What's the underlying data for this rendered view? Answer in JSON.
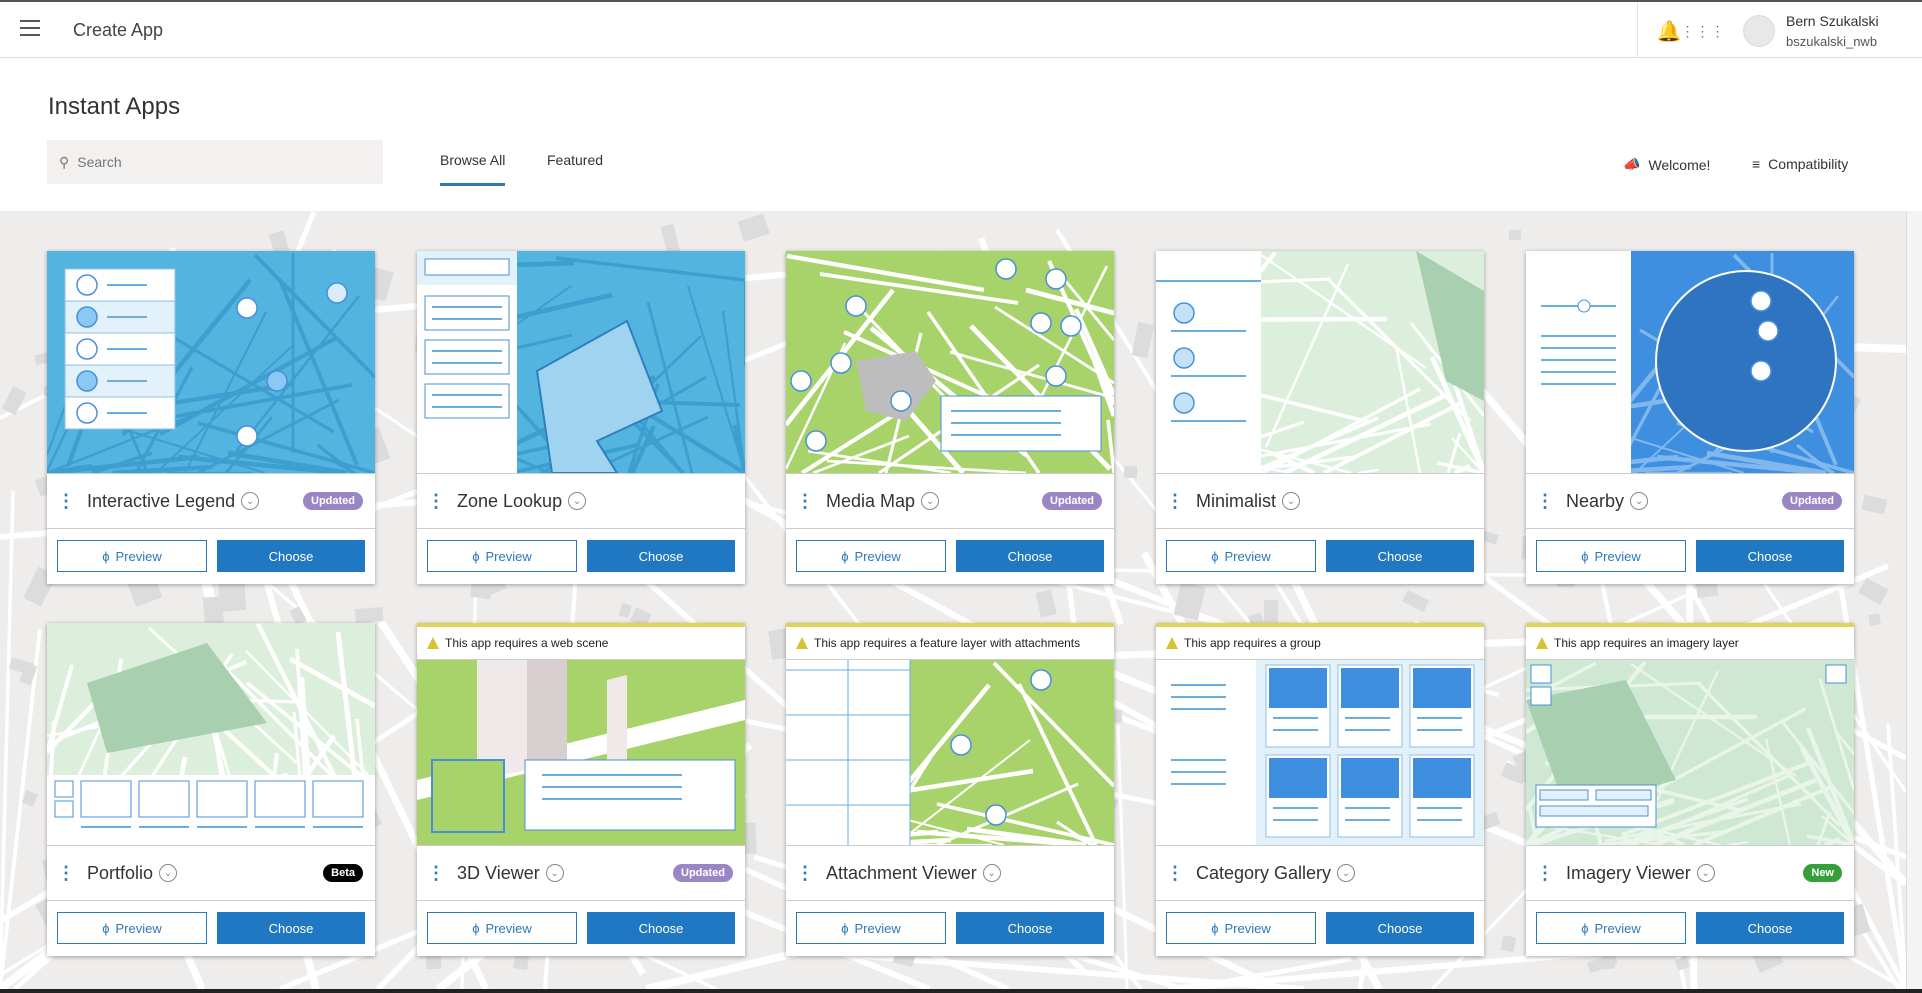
{
  "header": {
    "app_title": "Create App",
    "user_name": "Bern Szukalski",
    "user_login": "bszukalski_nwb",
    "icons": [
      "menu-icon",
      "bell-icon",
      "apps-grid-icon",
      "avatar"
    ]
  },
  "page": {
    "title": "Instant Apps",
    "search_placeholder": "Search",
    "tabs": [
      {
        "label": "Browse All",
        "active": true
      },
      {
        "label": "Featured",
        "active": false
      }
    ],
    "welcome": "Welcome!",
    "compatibility": "Compatibility"
  },
  "colors": {
    "accent": "#1f78c1",
    "updated": "#9a86c4",
    "new": "#35a03a",
    "beta": "#000000",
    "warning": "#e0d35a"
  },
  "buttons": {
    "preview": "Preview",
    "choose": "Choose"
  },
  "cards": [
    {
      "name": "Interactive Legend",
      "badge": "Updated",
      "badge_color": "#9a86c4",
      "warning": "",
      "art": "legend"
    },
    {
      "name": "Zone Lookup",
      "badge": "",
      "badge_color": "",
      "warning": "",
      "art": "zone"
    },
    {
      "name": "Media Map",
      "badge": "Updated",
      "badge_color": "#9a86c4",
      "warning": "",
      "art": "media"
    },
    {
      "name": "Minimalist",
      "badge": "",
      "badge_color": "",
      "warning": "",
      "art": "minimal"
    },
    {
      "name": "Nearby",
      "badge": "Updated",
      "badge_color": "#9a86c4",
      "warning": "",
      "art": "nearby"
    },
    {
      "name": "Portfolio",
      "badge": "Beta",
      "badge_color": "#000000",
      "warning": "",
      "art": "portfolio"
    },
    {
      "name": "3D Viewer",
      "badge": "Updated",
      "badge_color": "#9a86c4",
      "warning": "This app requires a web scene",
      "art": "3d"
    },
    {
      "name": "Attachment Viewer",
      "badge": "",
      "badge_color": "",
      "warning": "This app requires a feature layer with attachments",
      "art": "attach"
    },
    {
      "name": "Category Gallery",
      "badge": "",
      "badge_color": "",
      "warning": "This app requires a group",
      "art": "gallery"
    },
    {
      "name": "Imagery Viewer",
      "badge": "New",
      "badge_color": "#35a03a",
      "warning": "This app requires an imagery layer",
      "art": "imagery"
    }
  ]
}
